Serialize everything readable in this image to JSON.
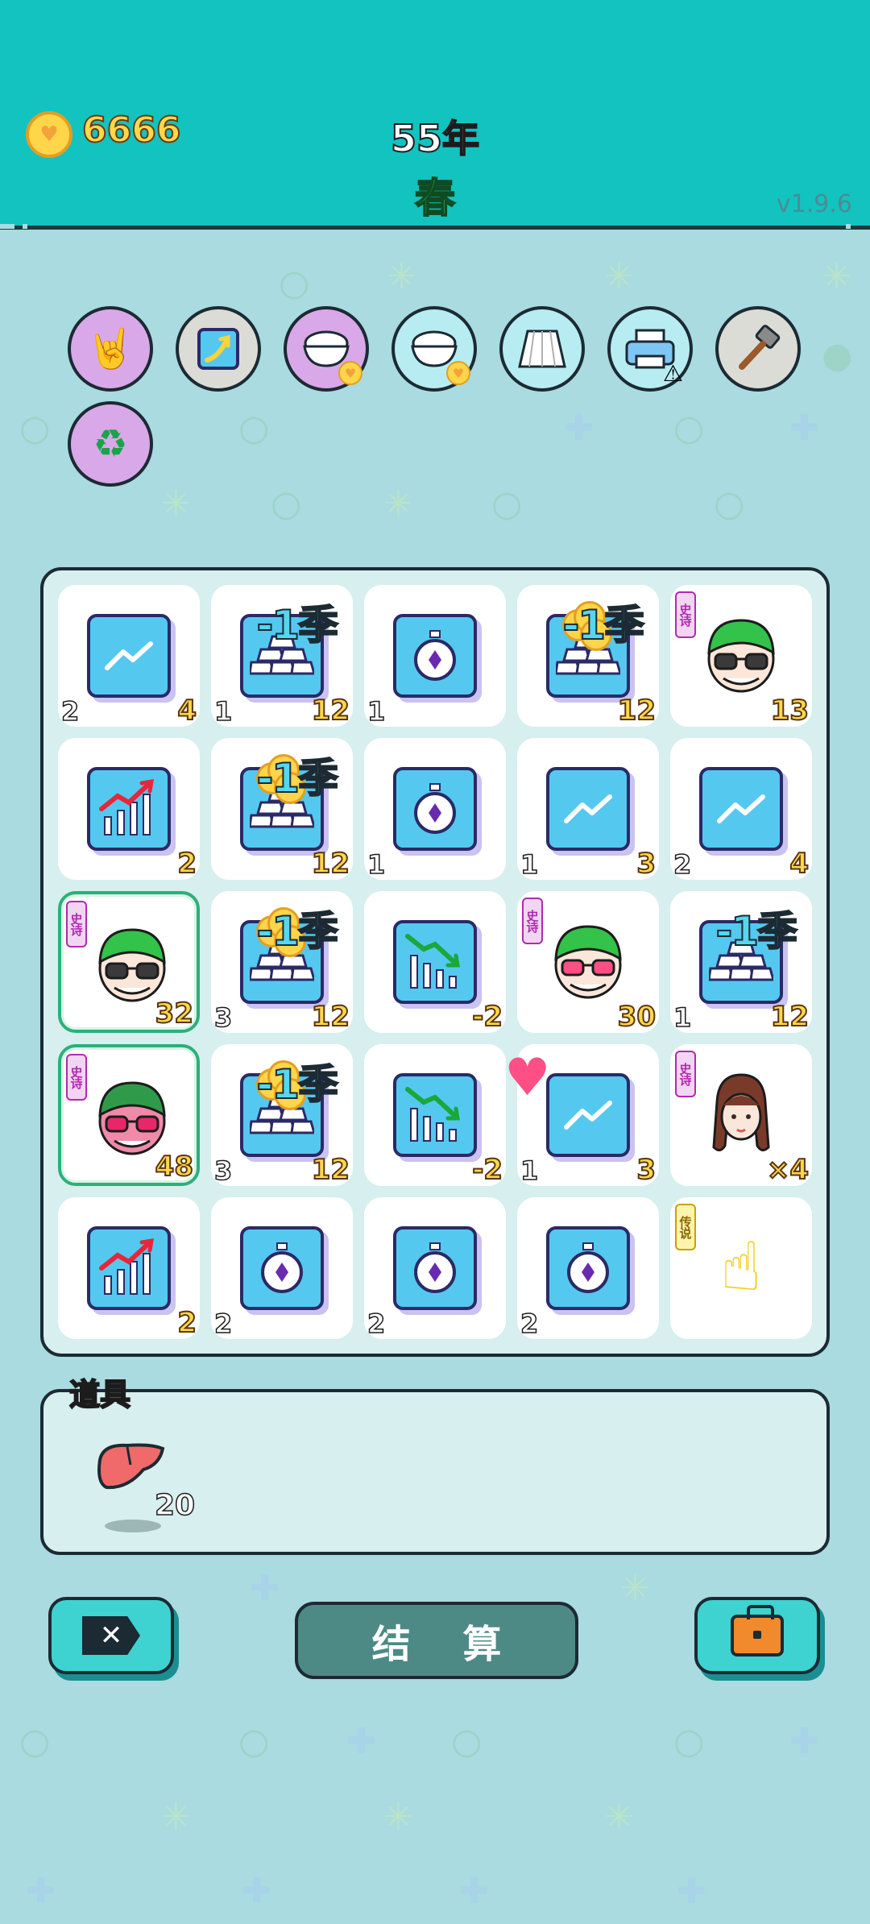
{
  "header": {
    "coins": "6666",
    "year": "55年",
    "season": "春",
    "version": "v1.9.6"
  },
  "skills": [
    {
      "icon": "rock-hand-icon",
      "bg": "#d9a8e8"
    },
    {
      "icon": "trend-card-icon",
      "bg": "#dcdcd6"
    },
    {
      "icon": "rice-bowl-coin-icon",
      "bg": "#d9a8e8"
    },
    {
      "icon": "rice-bowl-coin-icon",
      "bg": "#b7ecf2"
    },
    {
      "icon": "skirt-icon",
      "bg": "#b7ecf2"
    },
    {
      "icon": "printer-warning-icon",
      "bg": "#b7ecf2"
    },
    {
      "icon": "hammer-icon",
      "bg": "#dcdcd6"
    },
    {
      "icon": "recycle-icon",
      "bg": "#d9a8e8"
    }
  ],
  "board": {
    "cells": [
      {
        "type": "trend-up",
        "left": "2",
        "right": "4"
      },
      {
        "type": "gold-bars",
        "overlay": "-1季",
        "left": "1",
        "right": "12"
      },
      {
        "type": "stopwatch",
        "left": "1",
        "right": ""
      },
      {
        "type": "gold-bars-coins",
        "overlay": "-1季",
        "left": "",
        "right": "12"
      },
      {
        "type": "face-green-hat",
        "rarity": "史诗",
        "left": "",
        "right": "13"
      },
      {
        "type": "bar-chart-up",
        "left": "",
        "right": "2"
      },
      {
        "type": "gold-bars-coins",
        "overlay": "-1季",
        "left": "",
        "right": "12"
      },
      {
        "type": "stopwatch",
        "left": "1",
        "right": ""
      },
      {
        "type": "trend-up",
        "left": "1",
        "right": "3"
      },
      {
        "type": "trend-up",
        "left": "2",
        "right": "4"
      },
      {
        "type": "face-green-hat",
        "rarity": "史诗",
        "left": "",
        "right": "32",
        "selected": true
      },
      {
        "type": "gold-bars-coins",
        "overlay": "-1季",
        "left": "3",
        "right": "12"
      },
      {
        "type": "bar-chart-down",
        "left": "",
        "right": "-2"
      },
      {
        "type": "face-heart-glasses",
        "rarity": "史诗",
        "left": "",
        "right": "30"
      },
      {
        "type": "gold-bars",
        "overlay": "-1季",
        "left": "1",
        "right": "12"
      },
      {
        "type": "face-pink-glow",
        "rarity": "史诗",
        "left": "",
        "right": "48",
        "selected": true
      },
      {
        "type": "gold-bars-coins",
        "overlay": "-1季",
        "left": "3",
        "right": "12"
      },
      {
        "type": "bar-chart-down",
        "left": "",
        "right": "-2"
      },
      {
        "type": "trend-up",
        "left": "1",
        "right": "3"
      },
      {
        "type": "girl-braids",
        "rarity": "史诗",
        "left": "",
        "right": "×4"
      },
      {
        "type": "bar-chart-up",
        "left": "",
        "right": "2"
      },
      {
        "type": "stopwatch",
        "left": "2",
        "right": ""
      },
      {
        "type": "stopwatch",
        "left": "2",
        "right": ""
      },
      {
        "type": "stopwatch",
        "left": "2",
        "right": ""
      },
      {
        "type": "hand-point",
        "rarity": "传说",
        "left": "",
        "right": ""
      }
    ]
  },
  "items": {
    "label": "道具",
    "list": [
      {
        "icon": "liver-icon",
        "count": "20"
      }
    ]
  },
  "footer": {
    "settle_label": "结 算"
  }
}
